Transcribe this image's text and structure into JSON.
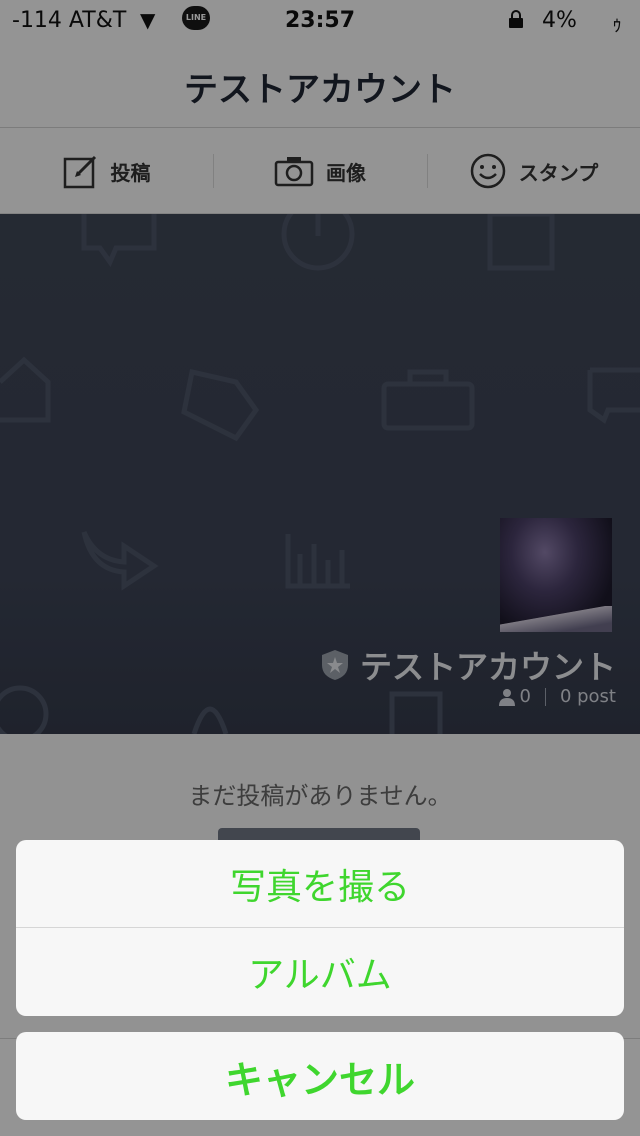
{
  "status_bar": {
    "carrier": "-114 AT&T",
    "line_badge": "LINE",
    "time": "23:57",
    "battery": "4%",
    "charge": "ｩ"
  },
  "nav": {
    "title": "テストアカウント"
  },
  "toolbar": {
    "post_label": "投稿",
    "image_label": "画像",
    "sticker_label": "スタンプ"
  },
  "cover": {
    "name": "テストアカウント",
    "followers": "0",
    "posts": "0 post"
  },
  "feed": {
    "empty_message": "まだ投稿がありません。"
  },
  "action_sheet": {
    "take_photo": "写真を撮る",
    "album": "アルバム",
    "cancel": "キャンセル",
    "accent_color": "#3fd62e"
  }
}
